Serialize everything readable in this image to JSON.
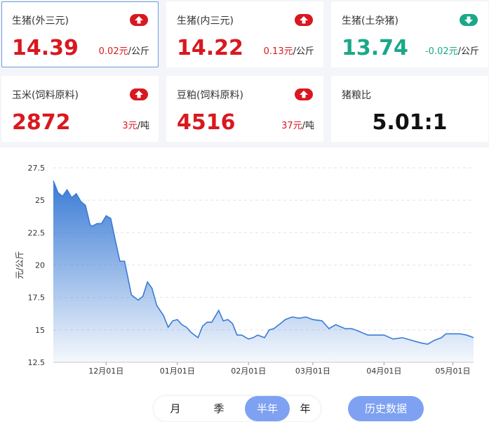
{
  "cards": [
    {
      "name": "生猪(外三元)",
      "value": "14.39",
      "change": "0.02元",
      "unit": "/公斤",
      "direction": "up"
    },
    {
      "name": "生猪(内三元)",
      "value": "14.22",
      "change": "0.13元",
      "unit": "/公斤",
      "direction": "up"
    },
    {
      "name": "生猪(土杂猪)",
      "value": "13.74",
      "change": "-0.02元",
      "unit": "/公斤",
      "direction": "down"
    },
    {
      "name": "玉米(饲料原料)",
      "value": "2872",
      "change": "3元",
      "unit": "/吨",
      "direction": "up"
    },
    {
      "name": "豆粕(饲料原料)",
      "value": "4516",
      "change": "37元",
      "unit": "/吨",
      "direction": "up"
    },
    {
      "name": "猪粮比",
      "value": "5.01:1"
    }
  ],
  "colors": {
    "up": "#d9181f",
    "down": "#1aa889",
    "line": "#3a7bd5",
    "accent": "#7ea1f2"
  },
  "chart_data": {
    "type": "area",
    "ylabel": "元/公斤",
    "ylim": [
      12.5,
      27.5
    ],
    "yticks": [
      "12.5",
      "15",
      "17.5",
      "20",
      "22.5",
      "25",
      "27.5"
    ],
    "xticks": [
      "12月01日",
      "01月01日",
      "02月01日",
      "03月01日",
      "04月01日",
      "05月01日"
    ],
    "xtick_dates": [
      "2020-12-01",
      "2021-01-01",
      "2021-02-01",
      "2021-03-01",
      "2021-04-01",
      "2021-05-01"
    ],
    "xlim": [
      "2020-11-08",
      "2021-05-10"
    ],
    "grid": "horizontal dashed",
    "series": [
      {
        "x": [
          "2020-11-08",
          "2020-11-10",
          "2020-11-12",
          "2020-11-14",
          "2020-11-16",
          "2020-11-18",
          "2020-11-20",
          "2020-11-22",
          "2020-11-24",
          "2020-11-25",
          "2020-11-27",
          "2020-11-29",
          "2020-12-01",
          "2020-12-03",
          "2020-12-05",
          "2020-12-07",
          "2020-12-09",
          "2020-12-12",
          "2020-12-15",
          "2020-12-17",
          "2020-12-19",
          "2020-12-21",
          "2020-12-23",
          "2020-12-26",
          "2020-12-28",
          "2020-12-30",
          "2021-01-01",
          "2021-01-03",
          "2021-01-05",
          "2021-01-07",
          "2021-01-10",
          "2021-01-12",
          "2021-01-14",
          "2021-01-16",
          "2021-01-19",
          "2021-01-21",
          "2021-01-23",
          "2021-01-25",
          "2021-01-27",
          "2021-01-29",
          "2021-02-01",
          "2021-02-03",
          "2021-02-05",
          "2021-02-08",
          "2021-02-10",
          "2021-02-12",
          "2021-02-15",
          "2021-02-17",
          "2021-02-20",
          "2021-02-23",
          "2021-02-26",
          "2021-03-01",
          "2021-03-05",
          "2021-03-08",
          "2021-03-11",
          "2021-03-15",
          "2021-03-18",
          "2021-03-21",
          "2021-03-25",
          "2021-03-28",
          "2021-04-01",
          "2021-04-05",
          "2021-04-09",
          "2021-04-13",
          "2021-04-17",
          "2021-04-20",
          "2021-04-23",
          "2021-04-26",
          "2021-04-28",
          "2021-05-01",
          "2021-05-04",
          "2021-05-07",
          "2021-05-10"
        ],
        "y": [
          26.5,
          25.6,
          25.3,
          25.8,
          25.2,
          25.5,
          24.9,
          24.6,
          23.1,
          23.0,
          23.2,
          23.2,
          23.8,
          23.6,
          21.9,
          20.3,
          20.3,
          17.7,
          17.3,
          17.6,
          18.7,
          18.2,
          16.9,
          16.1,
          15.2,
          15.7,
          15.8,
          15.4,
          15.2,
          14.8,
          14.4,
          15.3,
          15.6,
          15.6,
          16.5,
          15.7,
          15.8,
          15.5,
          14.6,
          14.6,
          14.3,
          14.4,
          14.6,
          14.4,
          15.0,
          15.1,
          15.5,
          15.8,
          16.0,
          15.9,
          16.0,
          15.8,
          15.7,
          15.1,
          15.4,
          15.1,
          15.1,
          14.9,
          14.6,
          14.6,
          14.6,
          14.3,
          14.4,
          14.2,
          14.0,
          13.9,
          14.2,
          14.4,
          14.7,
          14.7,
          14.7,
          14.6,
          14.4
        ]
      }
    ]
  },
  "controls": {
    "periods": [
      "月",
      "季",
      "半年",
      "年"
    ],
    "active_period": "半年",
    "history_label": "历史数据"
  }
}
